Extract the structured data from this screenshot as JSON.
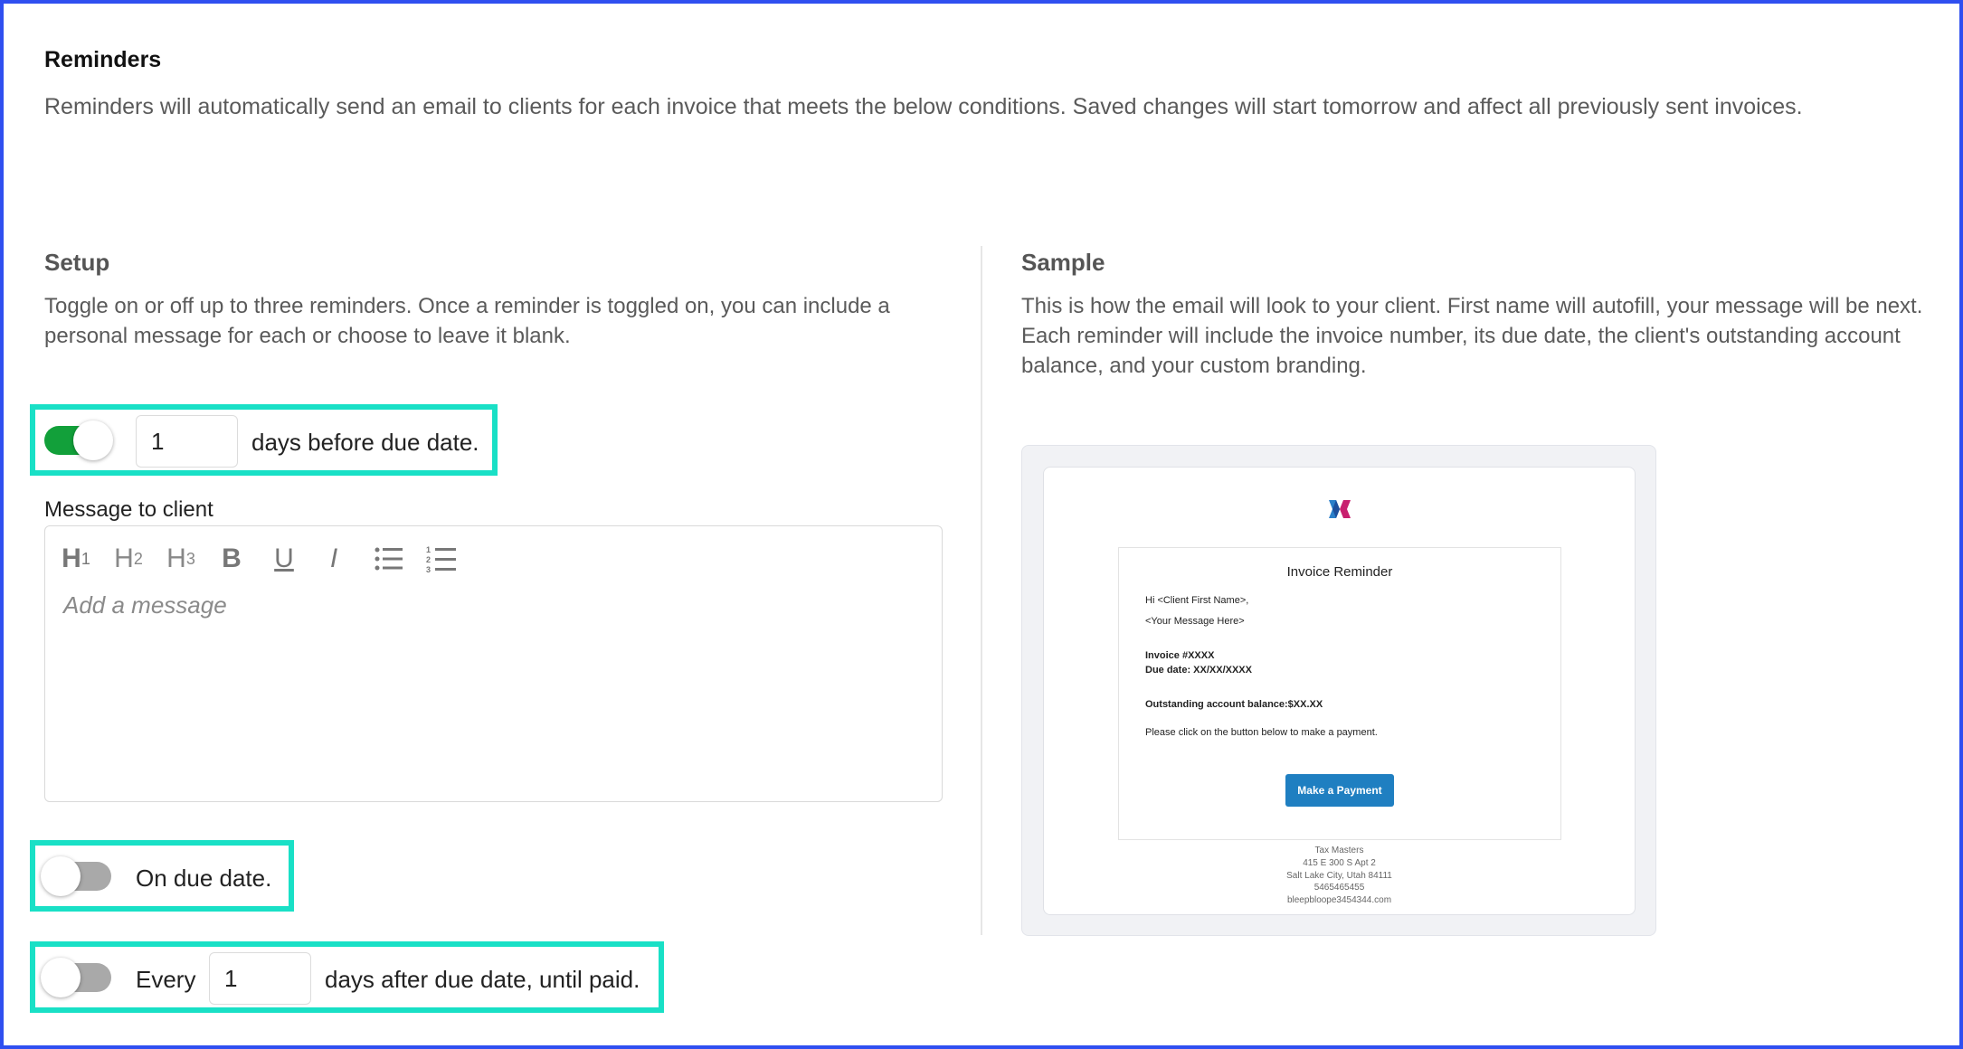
{
  "header": {
    "title": "Reminders",
    "description": "Reminders will automatically send an email to clients for each invoice that meets the below conditions. Saved changes will start tomorrow and affect all previously sent invoices."
  },
  "setup": {
    "title": "Setup",
    "description": "Toggle on or off up to three reminders. Once a reminder is toggled on, you can include a personal message for each or choose to leave it blank.",
    "reminder_before": {
      "enabled": true,
      "days": "1",
      "label": "days before due date."
    },
    "message": {
      "label": "Message to client",
      "placeholder": "Add a message",
      "toolbar": [
        "heading-1",
        "heading-2",
        "heading-3",
        "bold",
        "underline",
        "italic",
        "bulleted-list",
        "numbered-list"
      ]
    },
    "reminder_on": {
      "enabled": false,
      "label": "On due date."
    },
    "reminder_after": {
      "enabled": false,
      "prefix": "Every",
      "days": "1",
      "label": "days after due date, until paid."
    }
  },
  "sample": {
    "title": "Sample",
    "description": "This is how the email will look to your client. First name will autofill, your message will be next. Each reminder will include the invoice number, its due date, the client's outstanding account balance, and your custom branding.",
    "email": {
      "title": "Invoice Reminder",
      "greeting": "Hi <Client First Name>,",
      "message": "<Your Message Here>",
      "invoice": "Invoice #XXXX",
      "due_date": "Due date: XX/XX/XXXX",
      "balance": "Outstanding account balance:$XX.XX",
      "instruction": "Please click on the button below to make a payment.",
      "button": "Make a Payment",
      "footer": {
        "company": "Tax Masters",
        "address1": "415 E 300 S Apt 2",
        "address2": "Salt Lake City, Utah 84111",
        "phone": "5465465455",
        "email": "bleepbloope3454344.com"
      }
    }
  },
  "colors": {
    "frame": "#2f4ff0",
    "highlight": "#19e0c6",
    "toggle_on": "#12a03a",
    "toggle_off": "#a9a9a9",
    "button": "#1f7fc1"
  }
}
